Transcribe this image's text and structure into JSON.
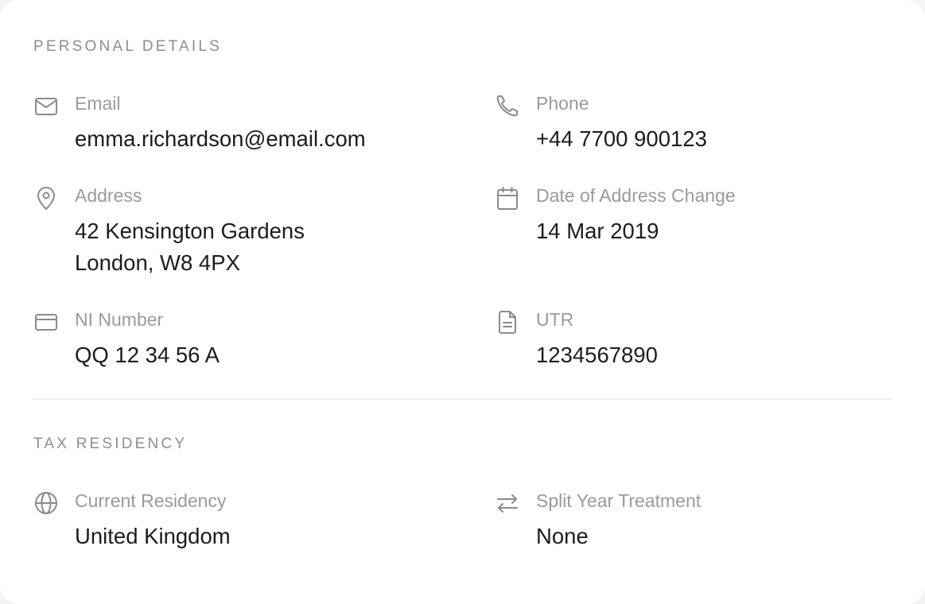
{
  "personal": {
    "heading": "PERSONAL DETAILS",
    "email": {
      "label": "Email",
      "value": "emma.richardson@email.com",
      "icon": "mail-icon"
    },
    "phone": {
      "label": "Phone",
      "value": "+44 7700 900123",
      "icon": "phone-icon"
    },
    "address": {
      "label": "Address",
      "line1": "42 Kensington Gardens",
      "line2": "London, W8 4PX",
      "icon": "map-pin-icon"
    },
    "address_change": {
      "label": "Date of Address Change",
      "value": "14 Mar 2019",
      "icon": "calendar-icon"
    },
    "ni": {
      "label": "NI Number",
      "value": "QQ 12 34 56 A",
      "icon": "credit-card-icon"
    },
    "utr": {
      "label": "UTR",
      "value": "1234567890",
      "icon": "document-icon"
    }
  },
  "residency": {
    "heading": "TAX RESIDENCY",
    "current": {
      "label": "Current Residency",
      "value": "United Kingdom",
      "icon": "globe-icon"
    },
    "split_year": {
      "label": "Split Year Treatment",
      "value": "None",
      "icon": "swap-arrows-icon"
    }
  },
  "colors": {
    "label": "#9a9a9f",
    "value": "#1c1c1e",
    "icon": "#8a8a8f",
    "divider": "#ececee"
  }
}
